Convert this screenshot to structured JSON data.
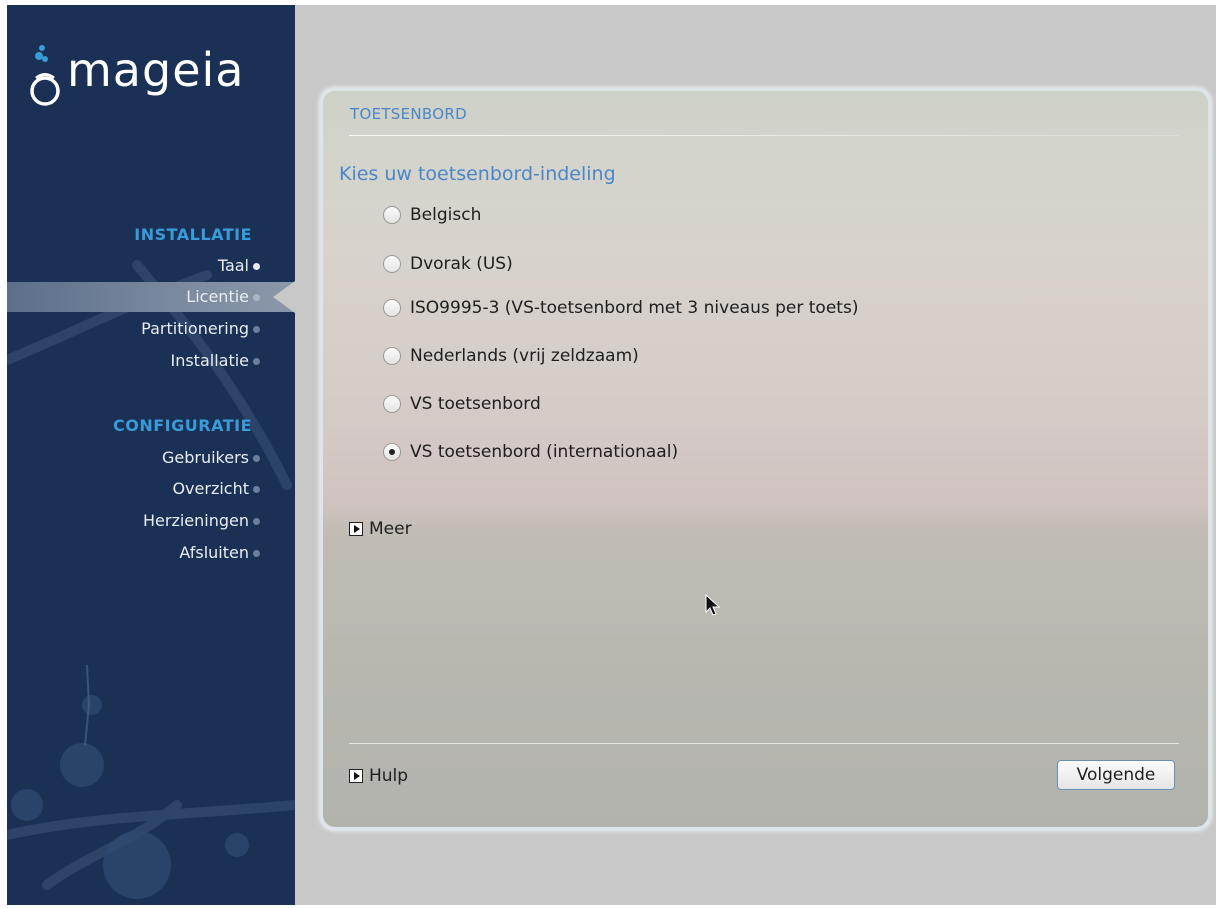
{
  "sidebar": {
    "logo_text": "mageia",
    "sections": [
      {
        "title": "INSTALLATIE",
        "items": [
          {
            "label": "Taal",
            "state": "done"
          },
          {
            "label": "Licentie",
            "state": "active"
          },
          {
            "label": "Partitionering",
            "state": "pending"
          },
          {
            "label": "Installatie",
            "state": "pending"
          }
        ]
      },
      {
        "title": "CONFIGURATIE",
        "items": [
          {
            "label": "Gebruikers",
            "state": "pending"
          },
          {
            "label": "Overzicht",
            "state": "pending"
          },
          {
            "label": "Herzieningen",
            "state": "pending"
          },
          {
            "label": "Afsluiten",
            "state": "pending"
          }
        ]
      }
    ]
  },
  "panel": {
    "title": "TOETSENBORD",
    "subtitle": "Kies uw toetsenbord-indeling",
    "options": [
      {
        "label": "Belgisch",
        "checked": false
      },
      {
        "label": "Dvorak (US)",
        "checked": false
      },
      {
        "label": "ISO9995-3 (VS-toetsenbord met 3 niveaus per toets)",
        "checked": false
      },
      {
        "label": "Nederlands (vrij zeldzaam)",
        "checked": false
      },
      {
        "label": "VS toetsenbord",
        "checked": false
      },
      {
        "label": "VS toetsenbord (internationaal)",
        "checked": true
      }
    ],
    "more_label": "Meer",
    "help_label": "Hulp",
    "next_label": "Volgende"
  },
  "colors": {
    "sidebar_bg": "#1a3055",
    "accent_blue": "#3a9bd9",
    "title_blue": "#4a86c7",
    "main_bg": "#c8c8c8"
  },
  "icons": [
    "mageia-logo-icon",
    "radio-icon",
    "expander-arrow-icon",
    "mouse-pointer-icon"
  ]
}
